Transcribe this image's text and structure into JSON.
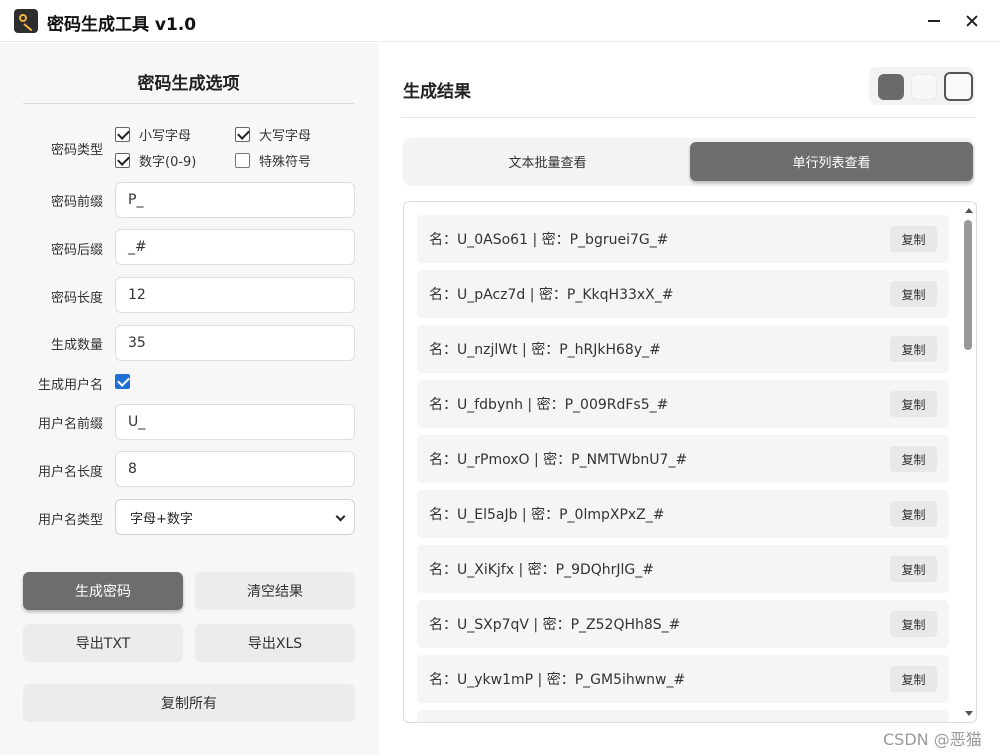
{
  "window": {
    "title": "密码生成工具 v1.0"
  },
  "options": {
    "heading": "密码生成选项",
    "password_type_label": "密码类型",
    "checkboxes": [
      {
        "label": "小写字母",
        "checked": true
      },
      {
        "label": "大写字母",
        "checked": true
      },
      {
        "label": "数字(0-9)",
        "checked": true
      },
      {
        "label": "特殊符号",
        "checked": false
      }
    ],
    "prefix": {
      "label": "密码前缀",
      "value": "P_"
    },
    "suffix": {
      "label": "密码后缀",
      "value": "_#"
    },
    "length": {
      "label": "密码长度",
      "value": "12"
    },
    "count": {
      "label": "生成数量",
      "value": "35"
    },
    "gen_username": {
      "label": "生成用户名",
      "checked": true
    },
    "username_prefix": {
      "label": "用户名前缀",
      "value": "U_"
    },
    "username_length": {
      "label": "用户名长度",
      "value": "8"
    },
    "username_type": {
      "label": "用户名类型",
      "value": "字母+数字"
    },
    "buttons": {
      "generate": "生成密码",
      "clear": "清空结果",
      "export_txt": "导出TXT",
      "export_xls": "导出XLS",
      "copy_all": "复制所有"
    }
  },
  "results": {
    "heading": "生成结果",
    "theme_colors": [
      "#6a6a6a",
      "#f8f8f8",
      "#fafafa"
    ],
    "tabs": [
      {
        "label": "文本批量查看",
        "active": false
      },
      {
        "label": "单行列表查看",
        "active": true
      }
    ],
    "copy_label": "复制",
    "rows": [
      "名：U_0ASo61 | 密：P_bgruei7G_#",
      "名：U_pAcz7d | 密：P_KkqH33xX_#",
      "名：U_nzjlWt | 密：P_hRJkH68y_#",
      "名：U_fdbynh | 密：P_009RdFs5_#",
      "名：U_rPmoxO | 密：P_NMTWbnU7_#",
      "名：U_El5aJb | 密：P_0lmpXPxZ_#",
      "名：U_XiKjfx | 密：P_9DQhrJlG_#",
      "名：U_SXp7qV | 密：P_Z52QHh8S_#",
      "名：U_ykw1mP | 密：P_GM5ihwnw_#"
    ]
  },
  "watermark": "CSDN @恶猫"
}
